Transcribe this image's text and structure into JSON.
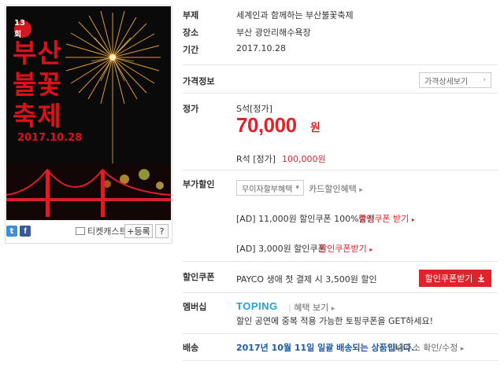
{
  "poster": {
    "edition": "13회",
    "title_lines": [
      "부산",
      "불꽃",
      "축제"
    ],
    "date": "2017.10.28"
  },
  "share": {
    "twitter_icon": "t",
    "facebook_icon": "f",
    "ticketcast_label": "티켓캐스트",
    "register_label": "+등록",
    "help_label": "?"
  },
  "details": {
    "title_label": "부제",
    "title_value": "세계인과 함께하는 부산불꽃축제",
    "venue_label": "장소",
    "venue_value": "부산 광안리해수욕장",
    "period_label": "기간",
    "period_value": "2017.10.28"
  },
  "price_info": {
    "label": "가격정보",
    "detail_button": "가격상세보기",
    "detail_chevron": "›"
  },
  "regular_price": {
    "label": "정가",
    "seat_s": "S석[정가]",
    "amount_s": "70,000",
    "unit_s": "원",
    "seat_r": "R석 [정가]",
    "amount_r": "100,000원"
  },
  "benefits": {
    "label": "부가할인",
    "installment_select": "무이자할부혜택",
    "installment_caret": "▾",
    "card_discount": "카드할인혜택",
    "card_chevron": "▸",
    "coupon1_text": "[AD] 11,000원 할인쿠폰 100%증정",
    "coupon1_link": "할인쿠폰 받기",
    "coupon2_text": "[AD] 3,000원 할인쿠폰",
    "coupon2_link": "할인쿠폰받기",
    "link_chevron": "▸"
  },
  "discount_coupon": {
    "label": "할인쿠폰",
    "text": "PAYCO 생애 첫 결제 시 3,500원 할인",
    "button": "할인쿠폰받기"
  },
  "membership": {
    "label": "멤버십",
    "logo": "TOPING",
    "benefit_link": "혜택 보기",
    "benefit_chevron": "▸",
    "description": "할인 공연에 중복 적용 가능한 토핑쿠폰을 GET하세요!"
  },
  "delivery": {
    "label": "배송",
    "notice": "2017년 10월 11일 일괄 배송되는 상품입니다.",
    "address_link": "배송주소 확인/수정",
    "address_chevron": "▸"
  },
  "colors": {
    "price_red": "#e0222b",
    "toping_blue": "#1fa5d8",
    "delivery_blue": "#1c5aa8"
  }
}
